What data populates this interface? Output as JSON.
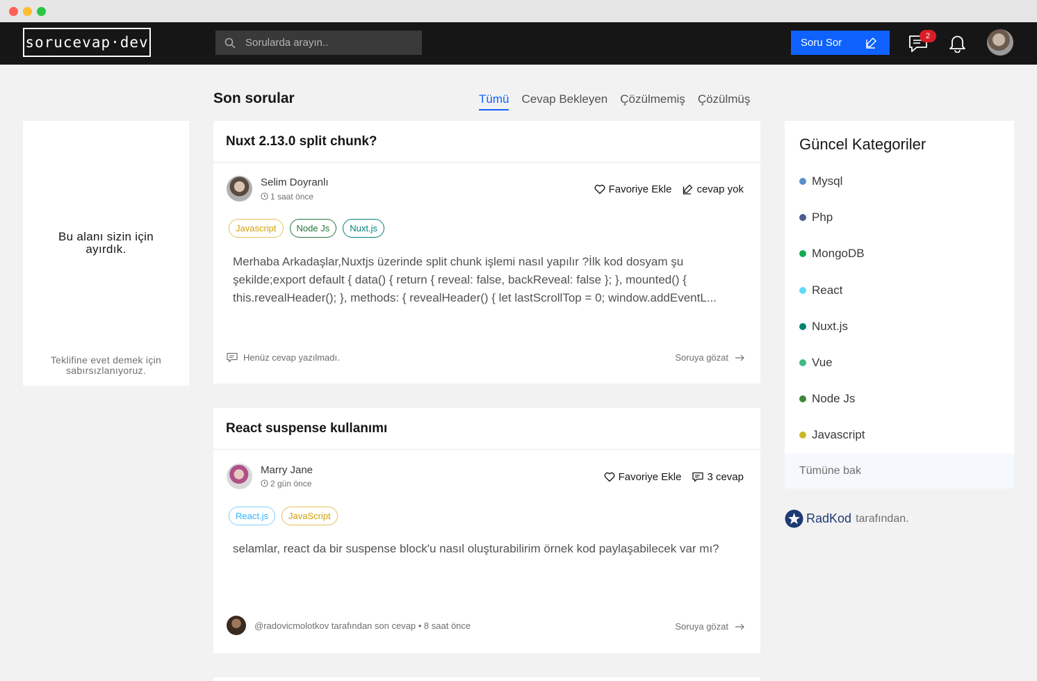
{
  "header": {
    "logo": "sorucevap·dev",
    "search_placeholder": "Sorularda arayın..",
    "ask_button": "Soru Sor",
    "message_badge": "2"
  },
  "main": {
    "title": "Son sorular",
    "tabs": [
      {
        "label": "Tümü",
        "active": true
      },
      {
        "label": "Cevap Bekleyen",
        "active": false
      },
      {
        "label": "Çözülmemiş",
        "active": false
      },
      {
        "label": "Çözülmüş",
        "active": false
      }
    ]
  },
  "ad": {
    "title": "Bu alanı sizin için ayırdık.",
    "subtitle": "Teklifine evet demek için sabırsızlanıyoruz."
  },
  "questions": [
    {
      "title": "Nuxt 2.13.0 split chunk?",
      "author": "Selim Doyranlı",
      "time": "1 saat önce",
      "favorite_label": "Favoriye Ekle",
      "answers_label": "cevap yok",
      "tags": [
        {
          "label": "Javascript",
          "color": "#d2a106"
        },
        {
          "label": "Node Js",
          "color": "#24a148"
        },
        {
          "label": "Nuxt.js",
          "color": "#007d79"
        }
      ],
      "excerpt": "Merhaba Arkadaşlar,Nuxtjs üzerinde split chunk işlemi nasıl yapılır ?İlk kod dosyam şu şekilde;export default { data() { return { reveal: false, backReveal: false }; }, mounted() { this.revealHeader(); }, methods: { revealHeader() { let lastScrollTop = 0; window.addEventL...",
      "footer_note": "Henüz cevap yazılmadı.",
      "browse_label": "Soruya gözat"
    },
    {
      "title": "React suspense kullanımı",
      "author": "Marry Jane",
      "time": "2 gün önce",
      "favorite_label": "Favoriye Ekle",
      "answers_label": "3 cevap",
      "tags": [
        {
          "label": "React.js",
          "color": "#33b1ff"
        },
        {
          "label": "JavaScript",
          "color": "#d2a106"
        }
      ],
      "excerpt": "selamlar, react da bir suspense block'u nasıl oluşturabilirim örnek kod paylaşabilecek var mı?",
      "footer_note": "@radovicmolotkov tarafından son cevap • 8 saat önce",
      "browse_label": "Soruya gözat"
    }
  ],
  "categories": {
    "title": "Güncel Kategoriler",
    "items": [
      {
        "label": "Mysql",
        "color": "#5b8fc7"
      },
      {
        "label": "Php",
        "color": "#4f5b93"
      },
      {
        "label": "MongoDB",
        "color": "#13aa52"
      },
      {
        "label": "React",
        "color": "#61dafb"
      },
      {
        "label": "Nuxt.js",
        "color": "#00836f"
      },
      {
        "label": "Vue",
        "color": "#42b883"
      },
      {
        "label": "Node Js",
        "color": "#3c873a"
      },
      {
        "label": "Javascript",
        "color": "#c8b82a"
      }
    ],
    "view_all": "Tümüne bak"
  },
  "credit": {
    "brand": "RadKod",
    "suffix": "tarafından."
  }
}
